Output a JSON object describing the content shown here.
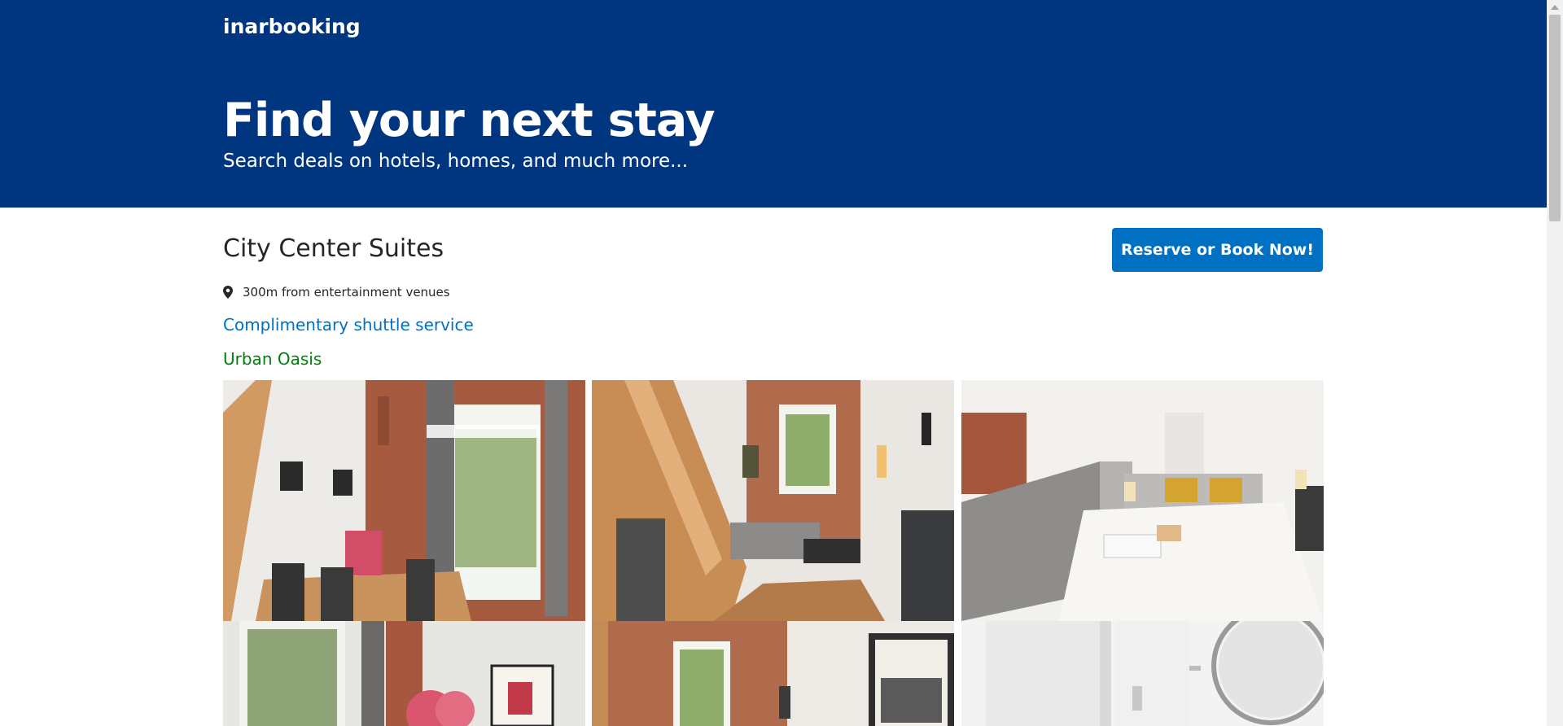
{
  "header": {
    "brand": "inarbooking",
    "title": "Find your next stay",
    "subtitle": "Search deals on hotels, homes, and much more...",
    "background_color": "#003580"
  },
  "hotel": {
    "name": "City Center Suites",
    "location_text": "300m from entertainment venues",
    "perk": "Complimentary shuttle service",
    "tag": "Urban Oasis",
    "book_button_label": "Reserve or Book Now!",
    "accent_color": "#0071c2",
    "tag_color": "#008009"
  },
  "gallery": {
    "photos": [
      {
        "subject": "dining-room-photo"
      },
      {
        "subject": "living-room-staircase-photo"
      },
      {
        "subject": "loft-bedroom-photo"
      },
      {
        "subject": "window-flowers-photo"
      },
      {
        "subject": "poster-window-photo"
      },
      {
        "subject": "bathroom-mirror-photo"
      }
    ]
  },
  "icons": {
    "location": "map-pin-icon"
  }
}
